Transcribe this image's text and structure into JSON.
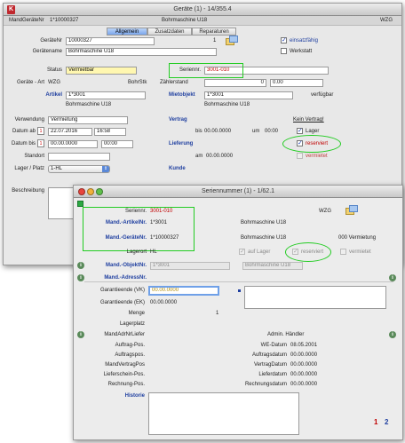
{
  "back_window": {
    "title": "Geräte (1) - 14/355.4",
    "header_left_label": "MandGeräteNr",
    "header_left_value": "1*10000327",
    "header_center_value": "Bohrmaschine U18",
    "header_right_value": "WZG",
    "tabs": [
      "Allgemein",
      "Zusatzdaten",
      "Reparaturen"
    ],
    "labels": {
      "geraete_nr": "GeräteNr",
      "geraetename": "Gerätename",
      "status": "Status",
      "geraete_art": "Geräte - Art",
      "artikel": "Artikel",
      "verwendung": "Verwendung",
      "datum_ab": "Datum ab",
      "datum_bis": "Datum bis",
      "standort": "Standort",
      "lager_platz": "Lager / Platz",
      "beschreibung": "Beschreibung",
      "seriennr": "Seriennr.",
      "bohrstk": "BohrStk",
      "zaehlerstand": "Zählerstand",
      "mietobjekt": "Mietobjekt",
      "vertrag": "Vertrag",
      "lieferung": "Lieferung",
      "kunde": "Kunde",
      "bis": "bis",
      "um": "um",
      "am": "am",
      "kein_vertrag": "Kein Vertrag!",
      "verfuegbar": "verfügbar"
    },
    "values": {
      "geraete_nr": "10000327",
      "geraete_nr_suffix": "1",
      "geraetename": "Bohrmaschine U18",
      "status": "Vermietbar",
      "geraete_art": "WZG",
      "artikel": "1*3001",
      "artikel_desc": "Bohrmaschine U18",
      "verwendung": "Vermietung",
      "datum_ab": "22.07.2016",
      "datum_ab_time": "16:58",
      "datum_bis": "00.00.0000",
      "datum_bis_time": "00:00",
      "lager_platz": "1-HL",
      "seriennr": "3001-010",
      "zaehler_1": "0",
      "zaehler_2": "0.00",
      "mietobjekt": "1*3001",
      "mietobjekt_desc": "Bohrmaschine U18",
      "vertrag_bis": "00.00.0000",
      "vertrag_um": "00:00",
      "lieferung_am": "00.00.0000"
    },
    "checkboxes": {
      "einsatzfaehig": "einsatzfähig",
      "werkstatt": "Werkstatt",
      "lager": "Lager",
      "reserviert": "reserviert",
      "vermietet": "vermietet"
    }
  },
  "front_window": {
    "title": "Seriennummer (1) - 1/62.1",
    "header_right_value": "WZG",
    "labels": {
      "seriennr": "Seriennr.",
      "mand_artikelnr": "Mand.-ArtikelNr.",
      "mand_geraetenr": "Mand.-GeräteNr.",
      "lagerort": "Lagerort",
      "mand_objektnr": "Mand.-ObjektNr.",
      "mand_adressnr": "Mand.-AdressNr.",
      "garantieende_vk": "Garantieende (VK)",
      "garantieende_ek": "Garantieende (EK)",
      "menge": "Menge",
      "lagerplatz": "Lagerplatz",
      "mandadrnr_lief": "MandAdrNrLiefer",
      "auftrag_pos": "Auftrag-Pos.",
      "auftragspos": "Auftragspos.",
      "mandvertragpos": "MandVertragPos",
      "liefers_pos": "Lieferschein-Pos.",
      "rechnung_pos": "Rechnung-Pos.",
      "historie": "Historie",
      "admin_haendler": "Admin. Händler",
      "we_datum": "WE-Datum",
      "auftragsdatum": "Auftragsdatum",
      "vertragdatum": "VertragDatum",
      "lieferdatum": "Lieferdatum",
      "rechnungsdatum": "Rechnungsdatum"
    },
    "values": {
      "seriennr": "3001-010",
      "mand_artikelnr": "1*3001",
      "artikel_desc": "Bohrmaschine U18",
      "mand_geraetenr": "1*10000327",
      "geraet_desc": "Bohrmaschine U18",
      "geraet_status": "000 Vermietung",
      "lagerort": "HL",
      "mand_objektnr": "1*3001",
      "objekt_desc": "Bohrmaschine U18",
      "garantieende_vk": "00.00.0000",
      "garantieende_ek": "00.00.0000",
      "menge": "1",
      "we_datum": "08.05.2001",
      "auftragsdatum": "00.00.0000",
      "vertragdatum": "00.00.0000",
      "lieferdatum": "00.00.0000",
      "rechnungsdatum": "00.00.0000"
    },
    "checkboxes": {
      "auf_lager": "auf Lager",
      "reserviert": "reserviert",
      "vermietet": "vermietet"
    },
    "pager": {
      "page1": "1",
      "page2": "2"
    }
  },
  "colors": {
    "accent_blue": "#1f3fa0",
    "highlight_green": "#22cc22",
    "red_value": "#c00000"
  }
}
